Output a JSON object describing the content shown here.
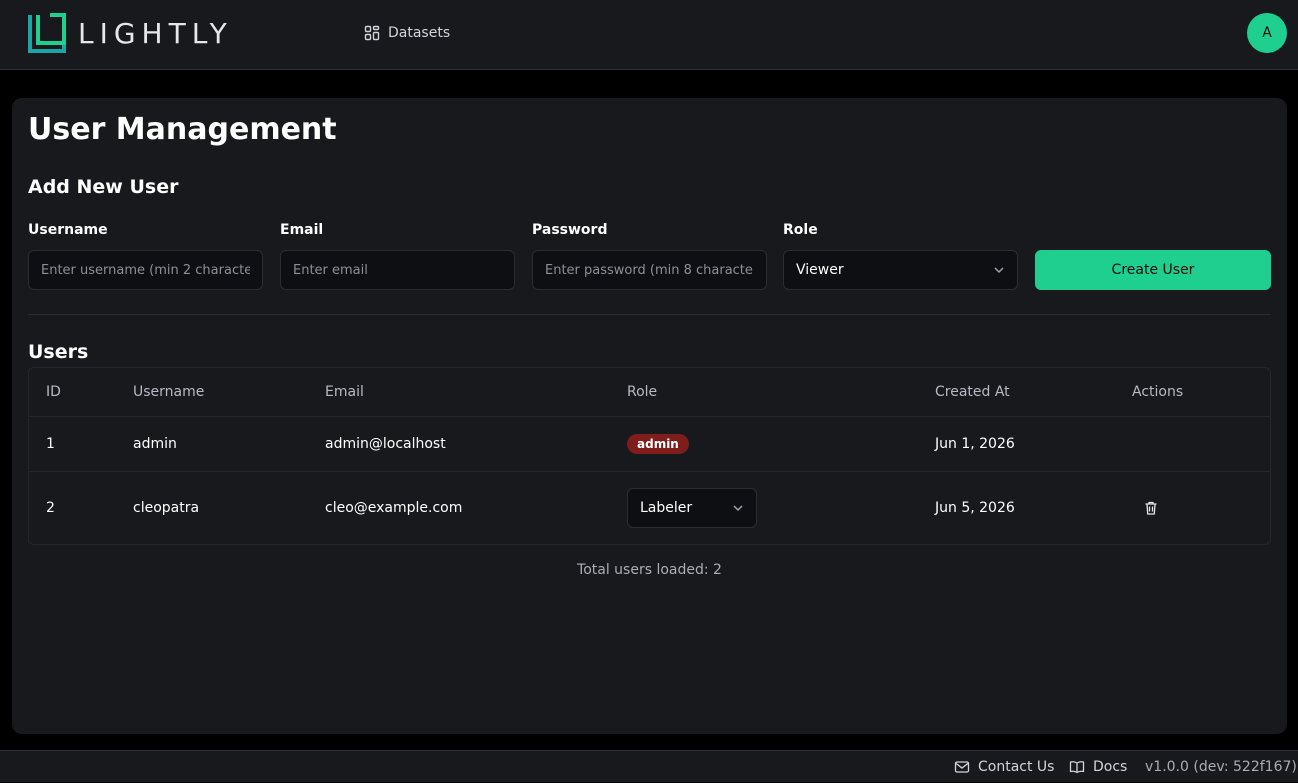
{
  "header": {
    "logo_text": "LIGHTLY",
    "nav": {
      "datasets_label": "Datasets",
      "datasets_icon": "grid-icon"
    },
    "avatar_initial": "A"
  },
  "page": {
    "title": "User Management",
    "add_section_title": "Add New User",
    "form": {
      "username_label": "Username",
      "username_placeholder": "Enter username (min 2 characte",
      "email_label": "Email",
      "email_placeholder": "Enter email",
      "password_label": "Password",
      "password_placeholder": "Enter password (min 8 character",
      "role_label": "Role",
      "role_value": "Viewer",
      "create_button": "Create User"
    },
    "users_section_title": "Users",
    "table": {
      "columns": [
        "ID",
        "Username",
        "Email",
        "Role",
        "Created At",
        "Actions"
      ],
      "rows": [
        {
          "id": "1",
          "username": "admin",
          "email": "admin@localhost",
          "role": "admin",
          "created_at": "Jun 1, 2026"
        },
        {
          "id": "2",
          "username": "cleopatra",
          "email": "cleo@example.com",
          "role": "Labeler",
          "created_at": "Jun 5, 2026"
        }
      ]
    },
    "total_text": "Total users loaded: 2"
  },
  "footer": {
    "contact_label": "Contact Us",
    "docs_label": "Docs",
    "version": "v1.0.0 (dev: 522f167)"
  },
  "colors": {
    "accent": "#1ecf8f",
    "admin_badge": "#7f1d1d",
    "background": "#000000",
    "surface": "#18191d"
  }
}
